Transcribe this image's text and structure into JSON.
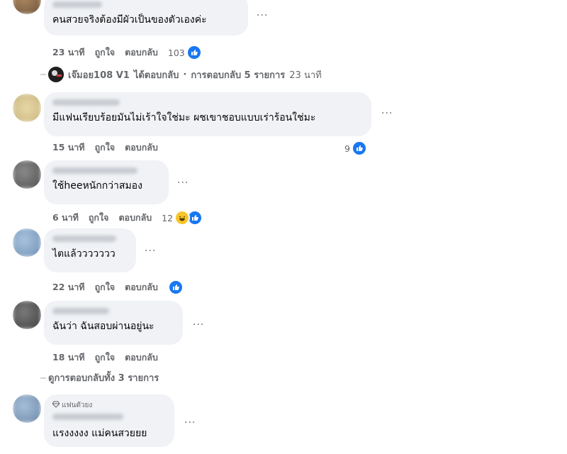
{
  "comments": [
    {
      "text": "คนสวยจริงต้องมีผัวเป็นของตัวเองค่ะ",
      "time": "23 นาที",
      "like": "ถูกใจ",
      "reply": "ตอบกลับ",
      "reaction_count": "103",
      "more": "···"
    },
    {
      "text": "มีแฟนเรียบร้อยมันไม่เร้าใจใช่มะ ผชเขาชอบแบบเร่าร้อนใช่มะ",
      "time": "15 นาที",
      "like": "ถูกใจ",
      "reply": "ตอบกลับ",
      "reaction_count": "9",
      "more": "···"
    },
    {
      "text": "ใช้heeหนักกว่าสมอง",
      "time": "6 นาที",
      "like": "ถูกใจ",
      "reply": "ตอบกลับ",
      "reaction_count": "12",
      "more": "···"
    },
    {
      "text": "ไตแล้ววววววว",
      "time": "22 นาที",
      "like": "ถูกใจ",
      "reply": "ตอบกลับ",
      "reaction_count": "",
      "more": "···"
    },
    {
      "text": "ฉันว่า ฉันสอบผ่านอยู่นะ",
      "time": "18 นาที",
      "like": "ถูกใจ",
      "reply": "ตอบกลับ",
      "more": "···"
    },
    {
      "badge": "แฟนตัวยง",
      "text": "แรงงงงง แม่คนสวยยย",
      "more": "···"
    }
  ],
  "reply_summary_1": {
    "author": "เจ๊มอย108 V1",
    "action": "ได้ตอบกลับ",
    "separator": "·",
    "count_text": "การตอบกลับ 5 รายการ",
    "time": "23 นาที"
  },
  "reply_summary_2": {
    "text": "ดูการตอบกลับทั้ง 3 รายการ"
  },
  "icons": {
    "like": "thumbs-up-icon",
    "haha": "haha-emoji-icon",
    "fan": "diamond-icon"
  },
  "colors": {
    "bubble": "#f0f2f5",
    "meta": "#65676b",
    "like_blue": "#1877f2"
  }
}
